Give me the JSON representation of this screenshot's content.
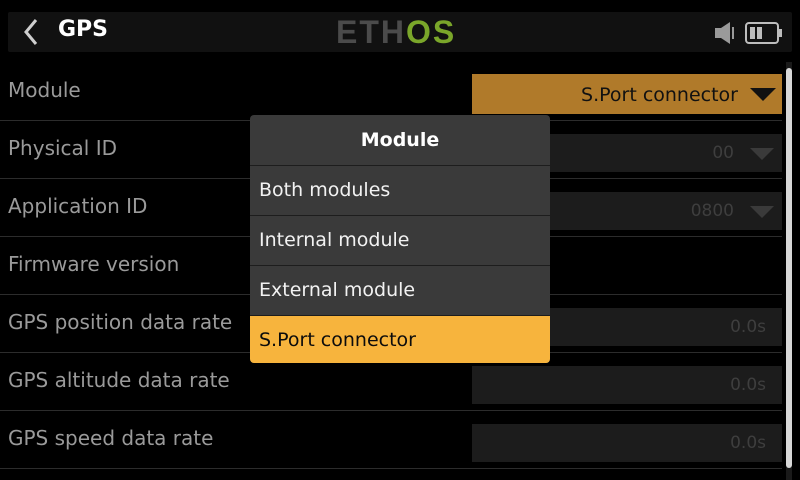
{
  "header": {
    "title": "GPS",
    "logo_part1": "ETH",
    "logo_part2": "OS",
    "icons": [
      "back-chevron-icon",
      "speaker-icon",
      "battery-icon"
    ]
  },
  "settings": [
    {
      "label": "Module",
      "value": "S.Port connector",
      "type": "dropdown"
    },
    {
      "label": "Physical ID",
      "value": "00",
      "type": "dropdown"
    },
    {
      "label": "Application ID",
      "value": "0800",
      "type": "dropdown"
    },
    {
      "label": "Firmware version",
      "value": "",
      "type": "text"
    },
    {
      "label": "GPS position data rate",
      "value": "0.0s",
      "type": "value"
    },
    {
      "label": "GPS altitude data rate",
      "value": "0.0s",
      "type": "value"
    },
    {
      "label": "GPS speed data rate",
      "value": "0.0s",
      "type": "value"
    }
  ],
  "popup": {
    "title": "Module",
    "options": [
      "Both modules",
      "Internal module",
      "External module",
      "S.Port connector"
    ],
    "selected": "S.Port connector"
  },
  "colors": {
    "accent": "#f7b43d",
    "module_select_bg": "#b07a2a",
    "logo_green": "#7aa62a"
  }
}
